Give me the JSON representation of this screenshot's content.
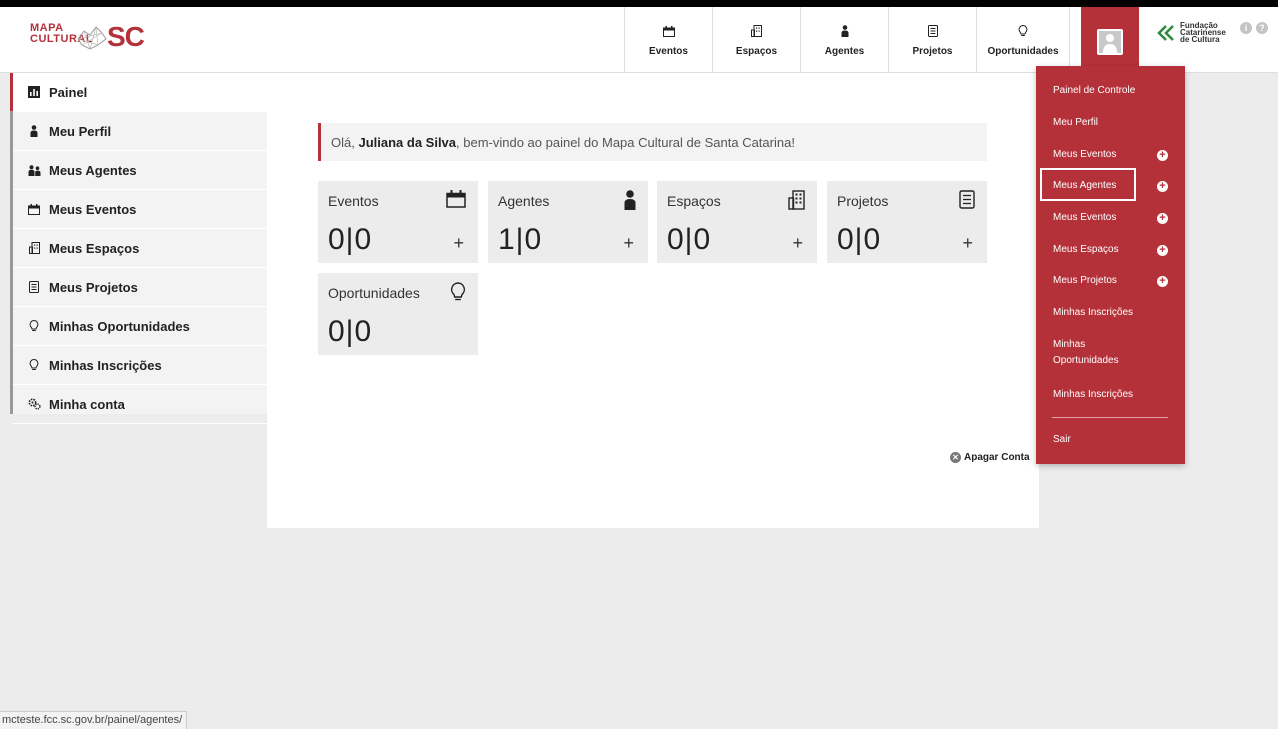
{
  "logo": {
    "line1": "MAPA",
    "line2": "CULTURAL",
    "state": "SC"
  },
  "nav": [
    {
      "label": "Eventos",
      "icon": "calendar-icon"
    },
    {
      "label": "Espaços",
      "icon": "building-icon"
    },
    {
      "label": "Agentes",
      "icon": "person-icon"
    },
    {
      "label": "Projetos",
      "icon": "document-icon"
    },
    {
      "label": "Oportunidades",
      "icon": "lightbulb-icon"
    }
  ],
  "fcc": {
    "line1": "Fundação",
    "line2": "Catarinense",
    "line3": "de Cultura"
  },
  "sidebar": {
    "items": [
      {
        "label": "Painel",
        "icon": "dashboard-icon"
      },
      {
        "label": "Meu Perfil",
        "icon": "person-icon"
      },
      {
        "label": "Meus Agentes",
        "icon": "people-icon"
      },
      {
        "label": "Meus Eventos",
        "icon": "calendar-icon"
      },
      {
        "label": "Meus Espaços",
        "icon": "building-icon"
      },
      {
        "label": "Meus Projetos",
        "icon": "document-icon"
      },
      {
        "label": "Minhas Oportunidades",
        "icon": "lightbulb-icon"
      },
      {
        "label": "Minhas Inscrições",
        "icon": "lightbulb-icon"
      },
      {
        "label": "Minha conta",
        "icon": "gears-icon"
      }
    ]
  },
  "welcome": {
    "prefix": "Olá,",
    "name": "Juliana da Silva",
    "suffix": ", bem-vindo ao painel do Mapa Cultural de Santa Catarina!"
  },
  "cards": [
    {
      "label": "Eventos",
      "value": "0|0",
      "plus": "+"
    },
    {
      "label": "Agentes",
      "value": "1|0",
      "plus": "+"
    },
    {
      "label": "Espaços",
      "value": "0|0",
      "plus": "+"
    },
    {
      "label": "Projetos",
      "value": "0|0",
      "plus": "+"
    },
    {
      "label": "Oportunidades",
      "value": "0|0"
    }
  ],
  "apagar": {
    "label": "Apagar Conta"
  },
  "dropdown": {
    "items": [
      {
        "label": "Painel de Controle"
      },
      {
        "label": "Meu Perfil"
      },
      {
        "label": "Meus Eventos"
      },
      {
        "label": "Meus Agentes"
      },
      {
        "label": "Meus Eventos"
      },
      {
        "label": "Meus Espaços"
      },
      {
        "label": "Meus Projetos"
      },
      {
        "label": "Minhas Inscrições"
      },
      {
        "label": "Minhas Oportunidades"
      },
      {
        "label": "Minhas Inscrições"
      },
      {
        "label": "Sair"
      }
    ],
    "add_symbol": "+"
  },
  "status": {
    "url": "mcteste.fcc.sc.gov.br/painel/agentes/"
  },
  "colors": {
    "accent": "#b5313a",
    "background": "#ececec"
  }
}
